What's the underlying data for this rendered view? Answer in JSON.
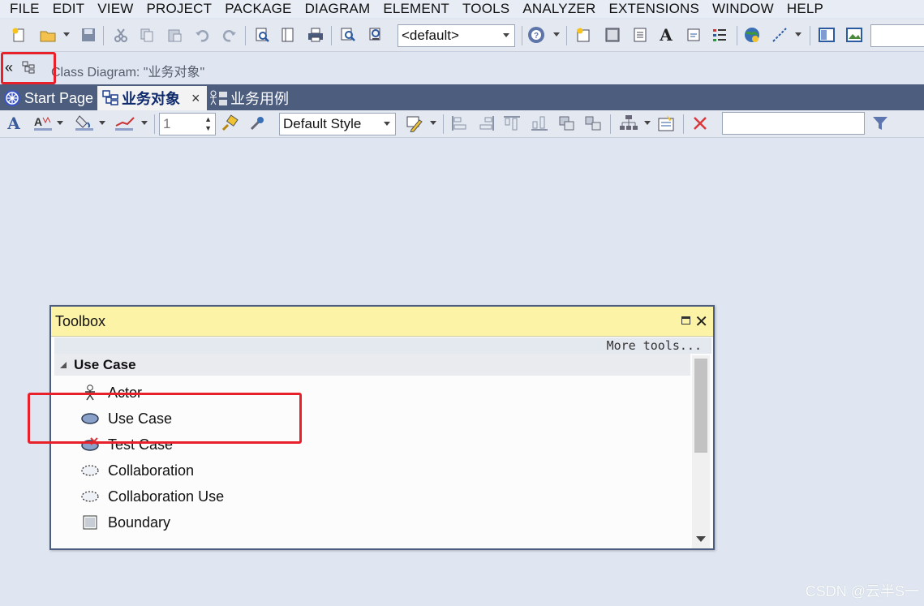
{
  "menu": [
    "FILE",
    "EDIT",
    "VIEW",
    "PROJECT",
    "PACKAGE",
    "DIAGRAM",
    "ELEMENT",
    "TOOLS",
    "ANALYZER",
    "EXTENSIONS",
    "WINDOW",
    "HELP"
  ],
  "main_toolbar": {
    "view_combo": "<default>"
  },
  "diagram_bar": {
    "collapse_glyph": "«",
    "title": "Class Diagram: \"业务对象\""
  },
  "tabs": [
    {
      "label": "Start Page",
      "icon": "start-page-icon",
      "active": false
    },
    {
      "label": "业务对象",
      "icon": "class-diagram-icon",
      "active": true
    },
    {
      "label": "业务用例",
      "icon": "use-case-diagram-icon",
      "active": false
    }
  ],
  "tab_close_glyph": "×",
  "diagram_toolbar": {
    "line_width": "1",
    "style_combo": "Default Style",
    "search_value": ""
  },
  "toolbox": {
    "title": "Toolbox",
    "more_tools": "More tools...",
    "section": "Use Case",
    "items": [
      {
        "label": "Actor",
        "icon": "actor-icon"
      },
      {
        "label": "Use Case",
        "icon": "use-case-icon"
      },
      {
        "label": "Test Case",
        "icon": "test-case-icon"
      },
      {
        "label": "Collaboration",
        "icon": "collaboration-icon"
      },
      {
        "label": "Collaboration Use",
        "icon": "collaboration-use-icon"
      },
      {
        "label": "Boundary",
        "icon": "boundary-icon"
      }
    ]
  },
  "watermark": "CSDN @云半S一",
  "colors": {
    "accent_red": "#e8202a",
    "tab_strip": "#4c5d7e",
    "toolbox_header": "#fdf3a7"
  }
}
